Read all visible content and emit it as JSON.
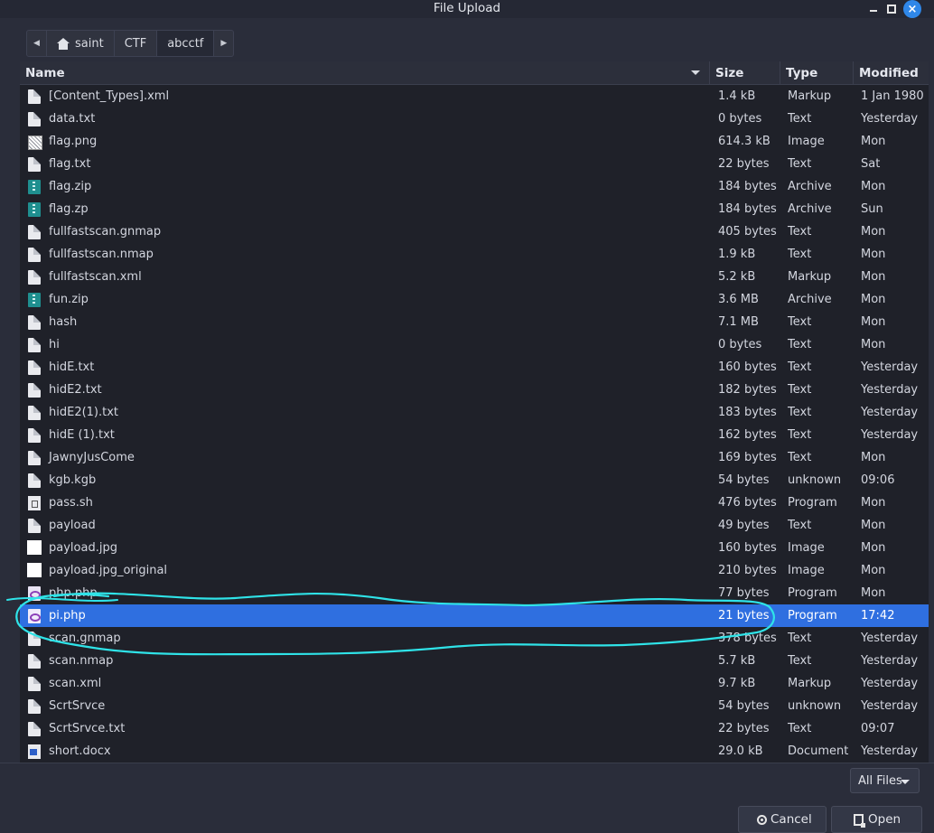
{
  "window": {
    "title": "File Upload"
  },
  "breadcrumbs": [
    "saint",
    "CTF",
    "abcctf"
  ],
  "columns": {
    "name": "Name",
    "size": "Size",
    "type": "Type",
    "modified": "Modified"
  },
  "files": [
    {
      "name": "[Content_Types].xml",
      "size": "1.4 kB",
      "type": "Markup",
      "modified": "1 Jan 1980",
      "icon": "xml-file-icon"
    },
    {
      "name": "data.txt",
      "size": "0 bytes",
      "type": "Text",
      "modified": "Yesterday",
      "icon": "text-file-icon"
    },
    {
      "name": "flag.png",
      "size": "614.3 kB",
      "type": "Image",
      "modified": "Mon",
      "icon": "image-file-icon"
    },
    {
      "name": "flag.txt",
      "size": "22 bytes",
      "type": "Text",
      "modified": "Sat",
      "icon": "text-file-icon"
    },
    {
      "name": "flag.zip",
      "size": "184 bytes",
      "type": "Archive",
      "modified": "Mon",
      "icon": "archive-file-icon"
    },
    {
      "name": "flag.zp",
      "size": "184 bytes",
      "type": "Archive",
      "modified": "Sun",
      "icon": "archive-file-icon"
    },
    {
      "name": "fullfastscan.gnmap",
      "size": "405 bytes",
      "type": "Text",
      "modified": "Mon",
      "icon": "text-file-icon"
    },
    {
      "name": "fullfastscan.nmap",
      "size": "1.9 kB",
      "type": "Text",
      "modified": "Mon",
      "icon": "text-file-icon"
    },
    {
      "name": "fullfastscan.xml",
      "size": "5.2 kB",
      "type": "Markup",
      "modified": "Mon",
      "icon": "xml-file-icon"
    },
    {
      "name": "fun.zip",
      "size": "3.6 MB",
      "type": "Archive",
      "modified": "Mon",
      "icon": "archive-file-icon"
    },
    {
      "name": "hash",
      "size": "7.1 MB",
      "type": "Text",
      "modified": "Mon",
      "icon": "text-file-icon"
    },
    {
      "name": "hi",
      "size": "0 bytes",
      "type": "Text",
      "modified": "Mon",
      "icon": "text-file-icon"
    },
    {
      "name": "hidE.txt",
      "size": "160 bytes",
      "type": "Text",
      "modified": "Yesterday",
      "icon": "text-file-icon"
    },
    {
      "name": "hidE2.txt",
      "size": "182 bytes",
      "type": "Text",
      "modified": "Yesterday",
      "icon": "text-file-icon"
    },
    {
      "name": "hidE2(1).txt",
      "size": "183 bytes",
      "type": "Text",
      "modified": "Yesterday",
      "icon": "text-file-icon"
    },
    {
      "name": "hidE (1).txt",
      "size": "162 bytes",
      "type": "Text",
      "modified": "Yesterday",
      "icon": "text-file-icon"
    },
    {
      "name": "JawnyJusCome",
      "size": "169 bytes",
      "type": "Text",
      "modified": "Mon",
      "icon": "text-file-icon"
    },
    {
      "name": "kgb.kgb",
      "size": "54 bytes",
      "type": "unknown",
      "modified": "09:06",
      "icon": "text-file-icon"
    },
    {
      "name": "pass.sh",
      "size": "476 bytes",
      "type": "Program",
      "modified": "Mon",
      "icon": "script-file-icon"
    },
    {
      "name": "payload",
      "size": "49 bytes",
      "type": "Text",
      "modified": "Mon",
      "icon": "text-file-icon"
    },
    {
      "name": "payload.jpg",
      "size": "160 bytes",
      "type": "Image",
      "modified": "Mon",
      "icon": "blank-image-icon"
    },
    {
      "name": "payload.jpg_original",
      "size": "210 bytes",
      "type": "Image",
      "modified": "Mon",
      "icon": "blank-image-icon"
    },
    {
      "name": "php.php",
      "size": "77 bytes",
      "type": "Program",
      "modified": "Mon",
      "icon": "php-file-icon"
    },
    {
      "name": "pi.php",
      "size": "21 bytes",
      "type": "Program",
      "modified": "17:42",
      "icon": "php-file-icon",
      "selected": true
    },
    {
      "name": "scan.gnmap",
      "size": "378 bytes",
      "type": "Text",
      "modified": "Yesterday",
      "icon": "text-file-icon"
    },
    {
      "name": "scan.nmap",
      "size": "5.7 kB",
      "type": "Text",
      "modified": "Yesterday",
      "icon": "text-file-icon"
    },
    {
      "name": "scan.xml",
      "size": "9.7 kB",
      "type": "Markup",
      "modified": "Yesterday",
      "icon": "xml-file-icon"
    },
    {
      "name": "ScrtSrvce",
      "size": "54 bytes",
      "type": "unknown",
      "modified": "Yesterday",
      "icon": "text-file-icon"
    },
    {
      "name": "ScrtSrvce.txt",
      "size": "22 bytes",
      "type": "Text",
      "modified": "09:07",
      "icon": "text-file-icon"
    },
    {
      "name": "short.docx",
      "size": "29.0 kB",
      "type": "Document",
      "modified": "Yesterday",
      "icon": "docx-file-icon"
    }
  ],
  "filter": {
    "label": "All Files"
  },
  "buttons": {
    "cancel": "Cancel",
    "open": "Open"
  },
  "colors": {
    "selection": "#2f6fe0",
    "annotation": "#2fe3e8",
    "close_button": "#2f87e8"
  }
}
